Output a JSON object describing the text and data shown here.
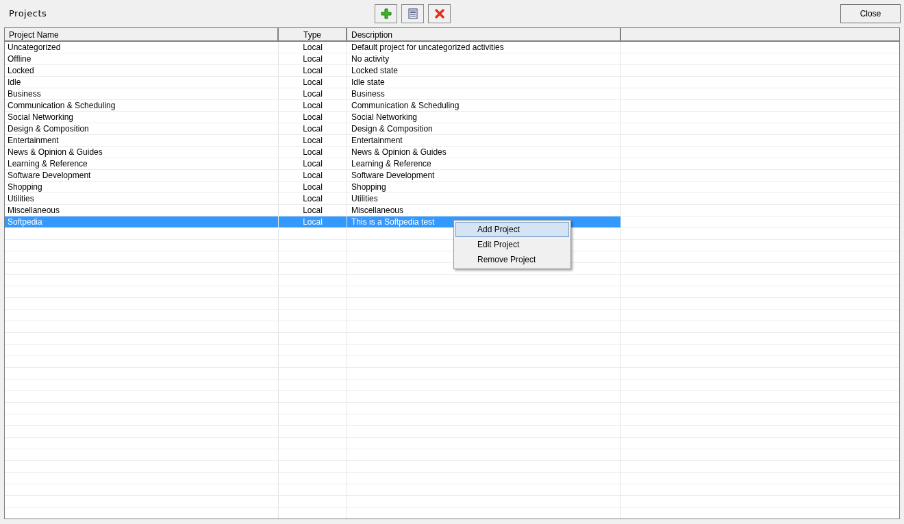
{
  "window": {
    "title": "Projects"
  },
  "toolbar": [
    {
      "kind": "add"
    },
    {
      "kind": "edit"
    },
    {
      "kind": "remove"
    }
  ],
  "close_button": "Close",
  "table": {
    "columns": [
      "Project Name",
      "Type",
      "Description"
    ],
    "rows": [
      {
        "name": "Uncategorized",
        "type": "Local",
        "description": "Default project for uncategorized activities",
        "selected": false
      },
      {
        "name": "Offline",
        "type": "Local",
        "description": "No activity",
        "selected": false
      },
      {
        "name": "Locked",
        "type": "Local",
        "description": "Locked state",
        "selected": false
      },
      {
        "name": "Idle",
        "type": "Local",
        "description": "Idle state",
        "selected": false
      },
      {
        "name": "Business",
        "type": "Local",
        "description": "Business",
        "selected": false
      },
      {
        "name": "Communication & Scheduling",
        "type": "Local",
        "description": "Communication & Scheduling",
        "selected": false
      },
      {
        "name": "Social Networking",
        "type": "Local",
        "description": "Social Networking",
        "selected": false
      },
      {
        "name": "Design & Composition",
        "type": "Local",
        "description": "Design & Composition",
        "selected": false
      },
      {
        "name": "Entertainment",
        "type": "Local",
        "description": "Entertainment",
        "selected": false
      },
      {
        "name": "News & Opinion & Guides",
        "type": "Local",
        "description": "News & Opinion & Guides",
        "selected": false
      },
      {
        "name": "Learning & Reference",
        "type": "Local",
        "description": "Learning & Reference",
        "selected": false
      },
      {
        "name": "Software Development",
        "type": "Local",
        "description": "Software Development",
        "selected": false
      },
      {
        "name": "Shopping",
        "type": "Local",
        "description": "Shopping",
        "selected": false
      },
      {
        "name": "Utilities",
        "type": "Local",
        "description": "Utilities",
        "selected": false
      },
      {
        "name": "Miscellaneous",
        "type": "Local",
        "description": "Miscellaneous",
        "selected": false
      },
      {
        "name": "Softpedia",
        "type": "Local",
        "description": "This is a Softpedia test",
        "selected": true
      }
    ]
  },
  "context_menu": [
    {
      "label": "Add Project",
      "selected": true
    },
    {
      "label": "Edit Project",
      "selected": false
    },
    {
      "label": "Remove Project",
      "selected": false
    }
  ]
}
